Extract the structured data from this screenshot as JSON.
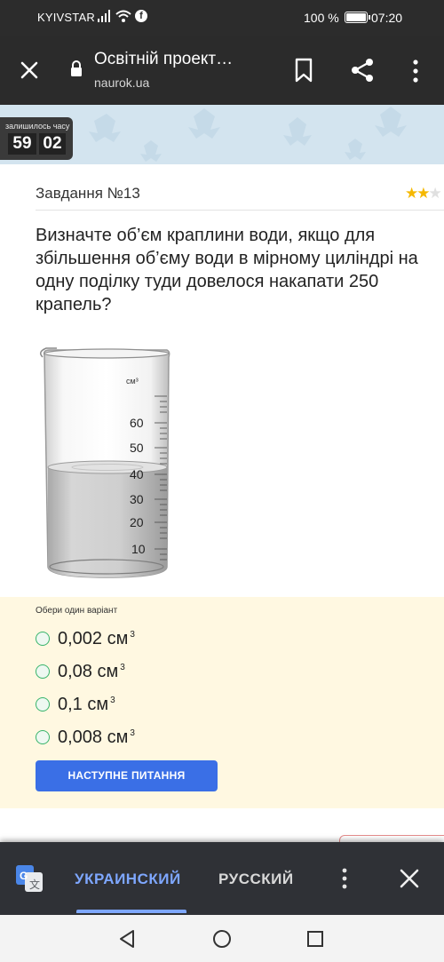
{
  "status_bar": {
    "carrier": "KYIVSTAR",
    "battery_percent": "100 %",
    "time": "07:20",
    "fb_glyph": "f"
  },
  "browser": {
    "title": "Освітній проект…",
    "url": "naurok.ua"
  },
  "timer": {
    "label": "залишилось часу",
    "minutes": "59",
    "seconds": "02"
  },
  "task": {
    "heading": "Завдання №13",
    "difficulty_stars": 2,
    "question": "Визначте об’єм краплини води, якщо для збільшення об’єму води в мірному циліндрі на одну поділку туди довелося накапати 250 крапель?"
  },
  "figure": {
    "unit_label": "см³",
    "scale_labels": [
      "60",
      "50",
      "40",
      "30",
      "20",
      "10"
    ]
  },
  "answers": {
    "hint": "Обери один варіант",
    "unit_sup": "3",
    "options": [
      {
        "text": "0,002 см"
      },
      {
        "text": "0,08 см"
      },
      {
        "text": "0,1 см"
      },
      {
        "text": "0,008 см"
      }
    ],
    "next_button": "НАСТУПНЕ ПИТАННЯ"
  },
  "translate_bar": {
    "language_active": "УКРАИНСКИЙ",
    "language_other": "РУССКИЙ"
  },
  "colors": {
    "accent_blue": "#3a6fe6",
    "radio_green": "#37b46b",
    "star_gold": "#f5b800",
    "answer_panel_bg": "#fff8e1"
  }
}
